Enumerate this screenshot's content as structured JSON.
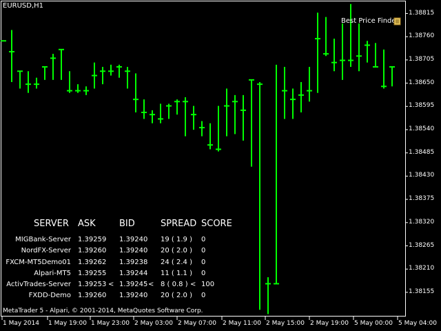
{
  "symbol": "EURUSD,H1",
  "indicator": {
    "label": "Best Price Finder",
    "icon": "scroll-icon"
  },
  "footer": "MetaTrader 5 - Alpari, © 2001-2014, MetaQuotes Software Corp.",
  "colors": {
    "background": "#000000",
    "bars": "#00ff00",
    "text": "#ffffff",
    "axis": "#ffffff"
  },
  "price_axis": [
    "1.38815",
    "1.38760",
    "1.38705",
    "1.38650",
    "1.38595",
    "1.38540",
    "1.38485",
    "1.38430",
    "1.38375",
    "1.38320",
    "1.38265",
    "1.38210",
    "1.38155"
  ],
  "time_axis": [
    "1 May 2014",
    "1 May 19:00",
    "1 May 23:00",
    "2 May 03:00",
    "2 May 07:00",
    "2 May 11:00",
    "2 May 15:00",
    "2 May 19:00",
    "5 May 00:00",
    "5 May 04:00"
  ],
  "table": {
    "headers": [
      "SERVER",
      "ASK",
      "BID",
      "SPREAD",
      "SCORE"
    ],
    "rows": [
      {
        "server": "MIGBank-Server",
        "ask": "1.39259",
        "ask_flag": "",
        "bid": "1.39240",
        "bid_flag": "",
        "spread": "19 ( 1.9 )",
        "spread_flag": "",
        "score": "0"
      },
      {
        "server": "NordFX-Server",
        "ask": "1.39260",
        "ask_flag": "",
        "bid": "1.39240",
        "bid_flag": "",
        "spread": "20 ( 2.0 )",
        "spread_flag": "",
        "score": "0"
      },
      {
        "server": "FXCM-MT5Demo01",
        "ask": "1.39262",
        "ask_flag": "",
        "bid": "1.39238",
        "bid_flag": "",
        "spread": "24 ( 2.4 )",
        "spread_flag": "",
        "score": "0"
      },
      {
        "server": "Alpari-MT5",
        "ask": "1.39255",
        "ask_flag": "",
        "bid": "1.39244",
        "bid_flag": "",
        "spread": "11 ( 1.1 )",
        "spread_flag": "",
        "score": "0"
      },
      {
        "server": "ActivTrades-Server",
        "ask": "1.39253",
        "ask_flag": "<",
        "bid": "1.39245",
        "bid_flag": "<",
        "spread": "8 ( 0.8 )",
        "spread_flag": "<",
        "score": "100"
      },
      {
        "server": "FXDD-Demo",
        "ask": "1.39260",
        "ask_flag": "",
        "bid": "1.39240",
        "bid_flag": "",
        "spread": "20 ( 2.0 )",
        "spread_flag": "",
        "score": "0"
      }
    ]
  },
  "chart_data": {
    "type": "ohlc",
    "ylim": [
      1.38126,
      1.38851
    ],
    "bars": [
      {
        "o": 1.3876,
        "h": 1.3876,
        "l": 1.3876,
        "c": 1.3876
      },
      {
        "o": 1.38735,
        "h": 1.38785,
        "l": 1.38665,
        "c": 1.38735
      },
      {
        "o": 1.3869,
        "h": 1.3869,
        "l": 1.3865,
        "c": 1.3869
      },
      {
        "o": 1.3866,
        "h": 1.3869,
        "l": 1.3864,
        "c": 1.3866
      },
      {
        "o": 1.3866,
        "h": 1.38675,
        "l": 1.3865,
        "c": 1.3866
      },
      {
        "o": 1.387,
        "h": 1.387,
        "l": 1.3867,
        "c": 1.387
      },
      {
        "o": 1.3872,
        "h": 1.3873,
        "l": 1.3867,
        "c": 1.3872
      },
      {
        "o": 1.3874,
        "h": 1.3874,
        "l": 1.3867,
        "c": 1.3874
      },
      {
        "o": 1.38645,
        "h": 1.3869,
        "l": 1.3864,
        "c": 1.38645
      },
      {
        "o": 1.38645,
        "h": 1.3866,
        "l": 1.3864,
        "c": 1.38645
      },
      {
        "o": 1.38645,
        "h": 1.38655,
        "l": 1.38635,
        "c": 1.38645
      },
      {
        "o": 1.3868,
        "h": 1.3871,
        "l": 1.3865,
        "c": 1.3868
      },
      {
        "o": 1.3869,
        "h": 1.387,
        "l": 1.3866,
        "c": 1.3869
      },
      {
        "o": 1.3869,
        "h": 1.38705,
        "l": 1.3868,
        "c": 1.3869
      },
      {
        "o": 1.387,
        "h": 1.38705,
        "l": 1.38675,
        "c": 1.387
      },
      {
        "o": 1.3869,
        "h": 1.387,
        "l": 1.3865,
        "c": 1.3869
      },
      {
        "o": 1.38625,
        "h": 1.38685,
        "l": 1.38595,
        "c": 1.38625
      },
      {
        "o": 1.38595,
        "h": 1.38625,
        "l": 1.3858,
        "c": 1.38595
      },
      {
        "o": 1.3859,
        "h": 1.386,
        "l": 1.3857,
        "c": 1.3859
      },
      {
        "o": 1.3858,
        "h": 1.38615,
        "l": 1.3857,
        "c": 1.3858
      },
      {
        "o": 1.3861,
        "h": 1.38615,
        "l": 1.3858,
        "c": 1.3861
      },
      {
        "o": 1.3862,
        "h": 1.38625,
        "l": 1.3859,
        "c": 1.3862
      },
      {
        "o": 1.3862,
        "h": 1.3863,
        "l": 1.3854,
        "c": 1.3862
      },
      {
        "o": 1.3859,
        "h": 1.3861,
        "l": 1.38555,
        "c": 1.3859
      },
      {
        "o": 1.3856,
        "h": 1.38575,
        "l": 1.3854,
        "c": 1.3856
      },
      {
        "o": 1.3852,
        "h": 1.3857,
        "l": 1.3851,
        "c": 1.3852
      },
      {
        "o": 1.3851,
        "h": 1.3861,
        "l": 1.38505,
        "c": 1.3851
      },
      {
        "o": 1.3861,
        "h": 1.3865,
        "l": 1.3854,
        "c": 1.3861
      },
      {
        "o": 1.3862,
        "h": 1.38635,
        "l": 1.38545,
        "c": 1.3862
      },
      {
        "o": 1.386,
        "h": 1.38635,
        "l": 1.3853,
        "c": 1.386
      },
      {
        "o": 1.3867,
        "h": 1.3867,
        "l": 1.3847,
        "c": 1.3867
      },
      {
        "o": 1.3866,
        "h": 1.38665,
        "l": 1.3814,
        "c": 1.3866
      },
      {
        "o": 1.382,
        "h": 1.38215,
        "l": 1.3813,
        "c": 1.382
      },
      {
        "o": 1.382,
        "h": 1.38705,
        "l": 1.382,
        "c": 1.382
      },
      {
        "o": 1.38645,
        "h": 1.387,
        "l": 1.3858,
        "c": 1.38645
      },
      {
        "o": 1.38625,
        "h": 1.3865,
        "l": 1.3858,
        "c": 1.38625
      },
      {
        "o": 1.38635,
        "h": 1.38665,
        "l": 1.38595,
        "c": 1.38635
      },
      {
        "o": 1.38645,
        "h": 1.387,
        "l": 1.3862,
        "c": 1.38645
      },
      {
        "o": 1.38765,
        "h": 1.38825,
        "l": 1.3864,
        "c": 1.38765
      },
      {
        "o": 1.3873,
        "h": 1.38815,
        "l": 1.38725,
        "c": 1.3873
      },
      {
        "o": 1.3871,
        "h": 1.38765,
        "l": 1.3869,
        "c": 1.3871
      },
      {
        "o": 1.38715,
        "h": 1.388,
        "l": 1.3867,
        "c": 1.38715
      },
      {
        "o": 1.38715,
        "h": 1.38845,
        "l": 1.387,
        "c": 1.38715
      },
      {
        "o": 1.38725,
        "h": 1.388,
        "l": 1.3869,
        "c": 1.38725
      },
      {
        "o": 1.3875,
        "h": 1.3876,
        "l": 1.3871,
        "c": 1.3875
      },
      {
        "o": 1.387,
        "h": 1.38755,
        "l": 1.387,
        "c": 1.387
      },
      {
        "o": 1.38655,
        "h": 1.3874,
        "l": 1.3865,
        "c": 1.38655
      },
      {
        "o": 1.387,
        "h": 1.387,
        "l": 1.38655,
        "c": 1.387
      }
    ]
  }
}
